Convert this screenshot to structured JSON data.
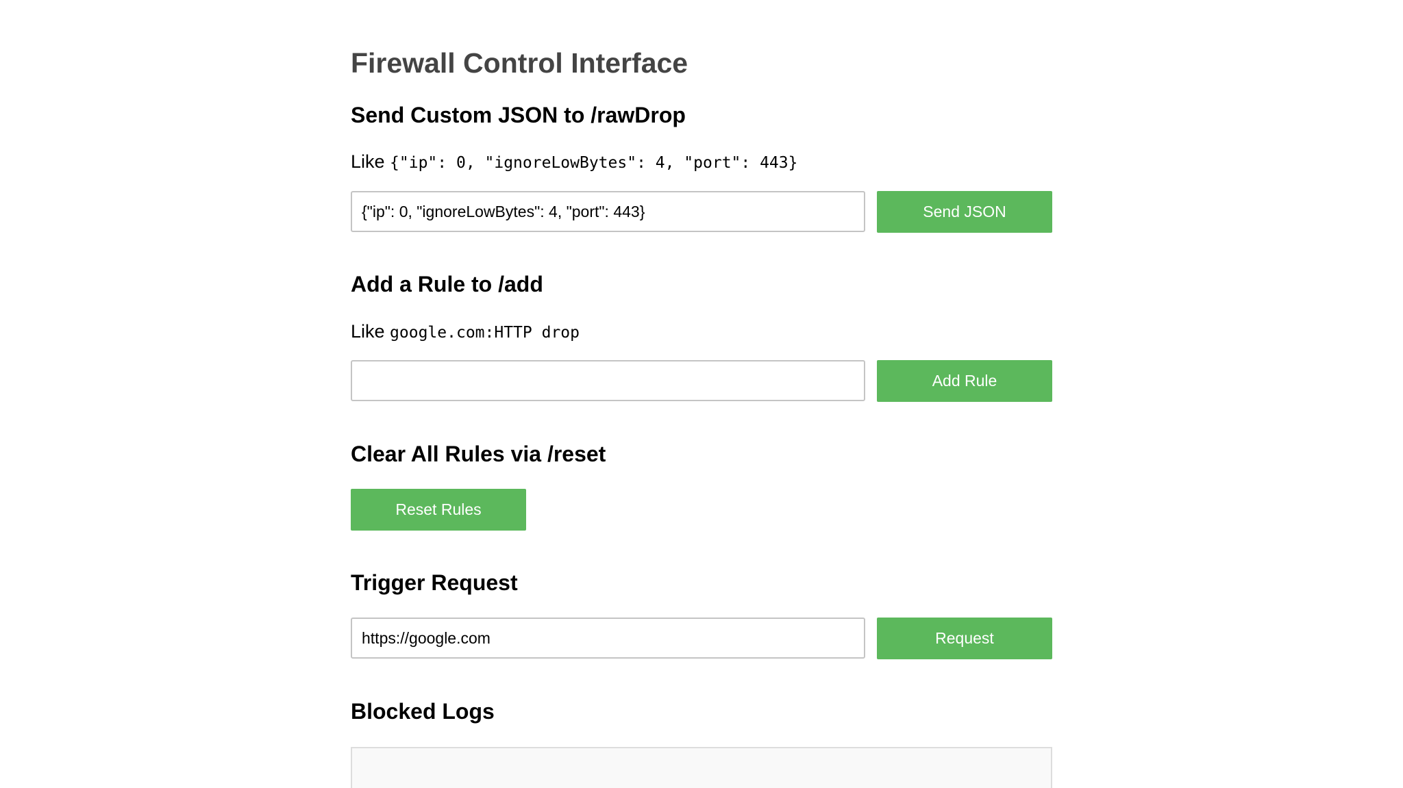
{
  "page": {
    "title": "Firewall Control Interface"
  },
  "raw_drop": {
    "heading": "Send Custom JSON to /rawDrop",
    "hint_prefix": "Like",
    "hint_code": "{\"ip\": 0, \"ignoreLowBytes\": 4, \"port\": 443}",
    "input_value": "{\"ip\": 0, \"ignoreLowBytes\": 4, \"port\": 443}",
    "button_label": "Send JSON"
  },
  "add_rule": {
    "heading": "Add a Rule to /add",
    "hint_prefix": "Like",
    "hint_code": "google.com:HTTP drop",
    "input_value": "",
    "button_label": "Add Rule"
  },
  "reset": {
    "heading": "Clear All Rules via /reset",
    "button_label": "Reset Rules"
  },
  "trigger": {
    "heading": "Trigger Request",
    "input_value": "https://google.com",
    "button_label": "Request"
  },
  "logs": {
    "heading": "Blocked Logs"
  },
  "colors": {
    "button_bg": "#5cb85c",
    "title_text": "#444444"
  }
}
